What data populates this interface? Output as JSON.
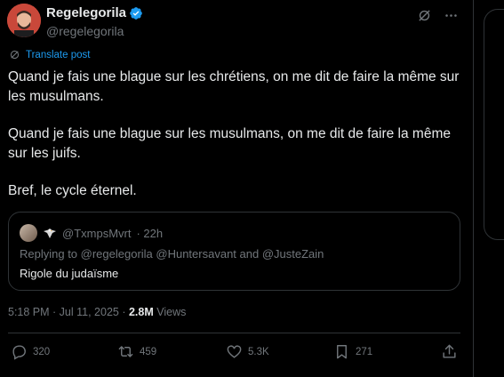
{
  "author": {
    "display_name": "Regelegorila",
    "handle": "@regelegorila",
    "verified": true
  },
  "translate_label": "Translate post",
  "tweet": {
    "paragraphs": [
      "Quand je fais une blague sur les chrétiens, on me dit de faire la même sur les musulmans.",
      "Quand je fais une blague sur les musulmans, on me dit de faire la même sur les juifs.",
      "Bref, le cycle éternel."
    ]
  },
  "quote": {
    "handle": "@TxmpsMvrt",
    "time": "· 22h",
    "replying_to": "Replying to @regelegorila @Huntersavant and @JusteZain",
    "text": "Rigole du judaïsme"
  },
  "meta": {
    "timestamp": "5:18 PM · Jul 11, 2025 · ",
    "views_count": "2.8M",
    "views_label": " Views"
  },
  "actions": {
    "replies": "320",
    "reposts": "459",
    "likes": "5.3K",
    "bookmarks": "271"
  },
  "colors": {
    "background": "#000000",
    "text": "#e7e9ea",
    "muted": "#71767b",
    "accent": "#1d9bf0",
    "border": "#2f3336"
  },
  "icons": [
    "verified-badge-icon",
    "grok-icon",
    "more-icon",
    "translate-icon",
    "reply-icon",
    "repost-icon",
    "like-icon",
    "bookmark-icon",
    "share-icon"
  ]
}
